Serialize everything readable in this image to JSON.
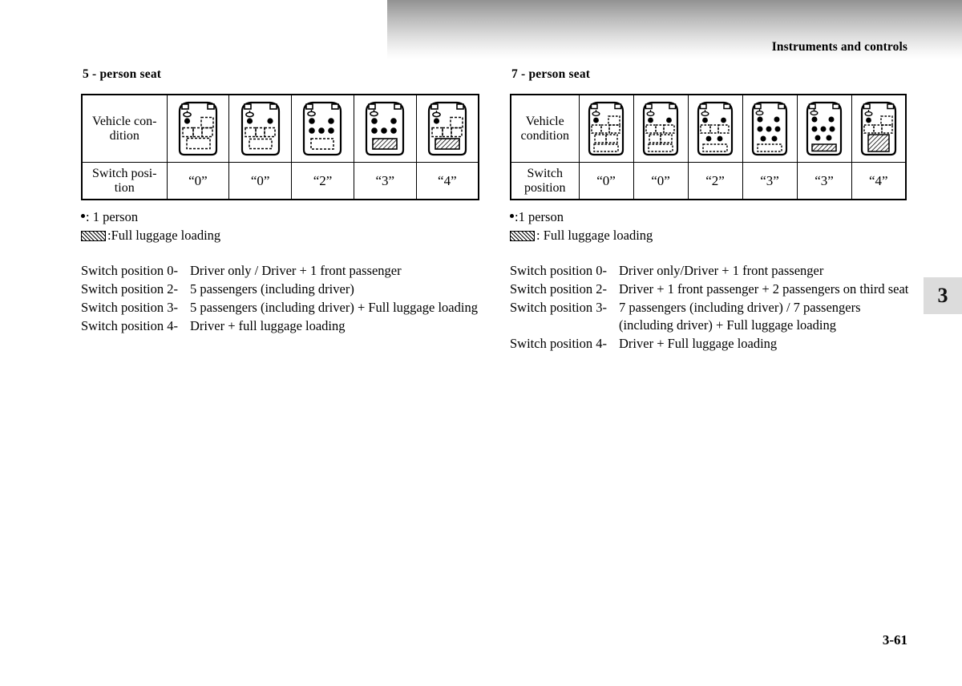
{
  "header": {
    "title": "Instruments and controls"
  },
  "chapter_tab": {
    "number": "3"
  },
  "page_number": "3-61",
  "left_section": {
    "title": "5 - person seat",
    "table": {
      "row_labels": [
        "Vehicle con-\ndition",
        "Switch posi-\ntion"
      ],
      "row_label_vehicle": "Vehicle condition",
      "row_label_switch": "Switch position",
      "switch_positions": [
        "“0”",
        "“0”",
        "“2”",
        "“3”",
        "“4”"
      ]
    },
    "legend": {
      "dot_text": ": 1 person",
      "hatch_text": ":Full luggage loading"
    },
    "switch_list": [
      {
        "label": "Switch position 0-",
        "desc": "Driver only / Driver + 1 front passenger"
      },
      {
        "label": "Switch position 2-",
        "desc": "5 passengers (including driver)"
      },
      {
        "label": "Switch position 3-",
        "desc": "5 passengers (including driver) + Full luggage loading"
      },
      {
        "label": "Switch position 4-",
        "desc": "Driver + full luggage loading"
      }
    ]
  },
  "right_section": {
    "title": "7 - person seat",
    "table": {
      "row_label_vehicle": "Vehicle condition",
      "row_label_switch": "Switch position",
      "switch_positions": [
        "“0”",
        "“0”",
        "“2”",
        "“3”",
        "“3”",
        "“4”"
      ]
    },
    "legend": {
      "dot_text": ":1 person",
      "hatch_text": ": Full luggage loading"
    },
    "switch_list": [
      {
        "label": "Switch position 0-",
        "desc": "Driver only/Driver + 1 front passenger"
      },
      {
        "label": "Switch position 2-",
        "desc": "Driver + 1 front passenger + 2 passengers on third seat"
      },
      {
        "label": "Switch position 3-",
        "desc": "7 passengers (including driver) / 7 passengers (including driver) + Full luggage loading"
      },
      {
        "label": "Switch position 4-",
        "desc": "Driver + Full luggage loading"
      }
    ]
  },
  "diagrams": {
    "five_seat": [
      {
        "name": "driver-only",
        "occupants": {
          "row1": [
            1,
            0
          ],
          "row2": [
            0,
            0,
            0
          ]
        },
        "cargo": "empty"
      },
      {
        "name": "driver-plus-front-passenger",
        "occupants": {
          "row1": [
            1,
            1
          ],
          "row2": [
            0,
            0,
            0
          ]
        },
        "cargo": "empty"
      },
      {
        "name": "five-passengers",
        "occupants": {
          "row1": [
            1,
            1
          ],
          "row2": [
            1,
            1,
            1
          ]
        },
        "cargo": "empty"
      },
      {
        "name": "five-passengers-full-luggage",
        "occupants": {
          "row1": [
            1,
            1
          ],
          "row2": [
            1,
            1,
            1
          ]
        },
        "cargo": "full"
      },
      {
        "name": "driver-full-luggage",
        "occupants": {
          "row1": [
            1,
            0
          ],
          "row2": [
            0,
            0,
            0
          ]
        },
        "cargo": "full"
      }
    ],
    "seven_seat": [
      {
        "name": "driver-only",
        "occupants": {
          "row1": [
            1,
            0
          ],
          "row2": [
            0,
            0,
            0
          ],
          "row3": [
            0,
            0
          ]
        },
        "cargo": "empty"
      },
      {
        "name": "driver-plus-front-passenger",
        "occupants": {
          "row1": [
            1,
            1
          ],
          "row2": [
            0,
            0,
            0
          ],
          "row3": [
            0,
            0
          ]
        },
        "cargo": "empty"
      },
      {
        "name": "driver-front-passenger-two-third-row",
        "occupants": {
          "row1": [
            1,
            1
          ],
          "row2": [
            0,
            0,
            0
          ],
          "row3": [
            1,
            1
          ]
        },
        "cargo": "empty"
      },
      {
        "name": "seven-passengers",
        "occupants": {
          "row1": [
            1,
            1
          ],
          "row2": [
            1,
            1,
            1
          ],
          "row3": [
            1,
            1
          ]
        },
        "cargo": "empty"
      },
      {
        "name": "seven-passengers-full-luggage",
        "occupants": {
          "row1": [
            1,
            1
          ],
          "row2": [
            1,
            1,
            1
          ],
          "row3": [
            1,
            1
          ]
        },
        "cargo": "full"
      },
      {
        "name": "driver-full-luggage",
        "occupants": {
          "row1": [
            1,
            0
          ],
          "row2": [
            0,
            0,
            0
          ],
          "row3": [
            0,
            0
          ]
        },
        "cargo": "full"
      }
    ]
  },
  "colors": {
    "header_gradient_dark": "#929292",
    "row_head_bg": "#e8e8e8",
    "chapter_tab_bg": "#dcdcdc",
    "ink": "#000000"
  }
}
